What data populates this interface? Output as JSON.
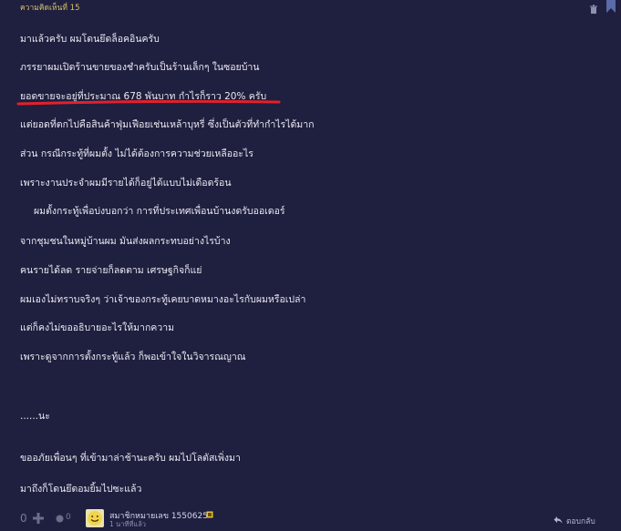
{
  "header": {
    "comment_number": "ความคิดเห็นที่ 15"
  },
  "body": {
    "lines": [
      "มาแล้วครับ ผมโดนยึดล็อคอินครับ",
      "ภรรยาผมเปิดร้านขายของชำครับเป็นร้านเล็กๆ ในซอยบ้าน",
      "ยอดขายจะอยู่ที่ประมาณ 678 พันบาท กำไรก็ราว 20% ครับ",
      "แต่ยอดที่ตกไปคือสินค้าฟุ่มเฟือยเช่นเหล้าบุหรี่ ซึ่งเป็นตัวที่ทำกำไรได้มาก",
      "ส่วน กรณีกระทู้ที่ผมตั้ง ไม่ได้ต้องการความช่วยเหลืออะไร",
      "เพราะงานประจำผมมีรายได้ก็อยู่ได้แบบไม่เดือดร้อน",
      "ผมตั้งกระทู้เพื่อบ่งบอกว่า การที่ประเทศเพื่อนบ้านงดรับออเดอร์",
      "จากชุมชนในหมู่บ้านผม มันส่งผลกระทบอย่างไรบ้าง",
      "คนรายได้ลด รายจ่ายก็ลดตาม เศรษฐกิจก็แย่",
      "ผมเองไม่ทราบจริงๆ ว่าเจ้าของกระทู้เคยบาดหมางอะไรกับผมหรือเปล่า",
      "แต่ก็คงไม่ขออธิบายอะไรให้มากความ",
      "เพราะดูจากการตั้งกระทู้แล้ว ก็พอเข้าใจในวิจารณญาณ",
      "......นะ",
      "ขออภัยเพื่อนๆ ที่เข้ามาล่าช้านะครับ ผมไปโลตัสเพิ่งมา",
      "มาถึงก็โดนยึดอมยิ้มไปซะแล้ว"
    ],
    "highlight_color": "#e3202b"
  },
  "footer": {
    "vote_count": "0",
    "emoji_count": "0",
    "member_name": "สมาชิกหมายเลข 1550625",
    "posted_time": "1 นาทีที่แล้ว",
    "reply_label": "ตอบกลับ"
  },
  "colors": {
    "background": "#1f1f3f",
    "accent_gold": "#d8c16a"
  }
}
